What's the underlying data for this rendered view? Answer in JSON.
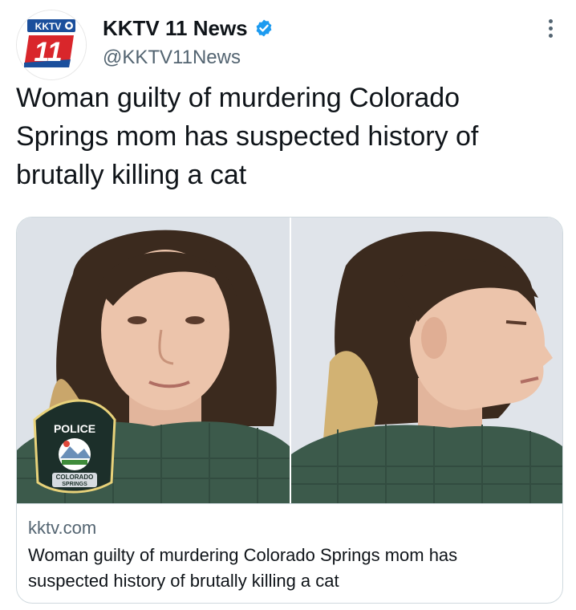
{
  "author": {
    "avatar_badge_top": "KKTV",
    "avatar_badge_number": "11",
    "display_name": "KKTV 11 News",
    "handle": "@KKTV11News",
    "verified": true,
    "verified_color": "#1d9bf0"
  },
  "menu": {
    "icon": "more-vertical-icon"
  },
  "tweet": {
    "text": "Woman guilty of murdering Colorado\nSprings mom has suspected history of\nbrutally killing a cat"
  },
  "link_card": {
    "image": {
      "badge_top_text": "POLICE",
      "badge_bottom_text_1": "COLORADO",
      "badge_bottom_text_2": "SPRINGS"
    },
    "domain": "kktv.com",
    "title": "Woman guilty of murdering Colorado Springs mom has\nsuspected history of brutally killing a cat"
  },
  "colors": {
    "text_primary": "#0f1419",
    "text_secondary": "#536471",
    "border": "#cfd9de",
    "brand_blue": "#1b4f9c",
    "brand_red": "#d9262b"
  }
}
